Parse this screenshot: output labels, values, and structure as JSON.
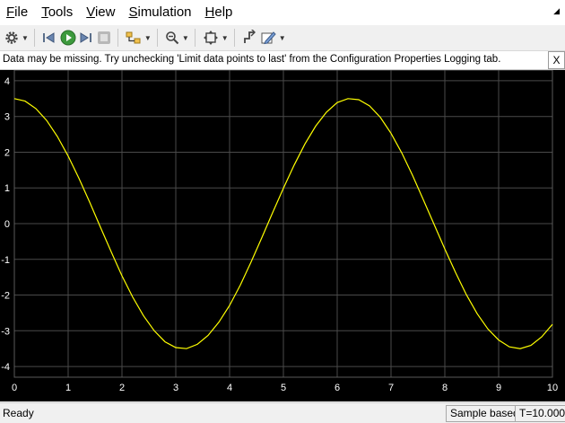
{
  "menu": {
    "items": [
      "File",
      "Tools",
      "View",
      "Simulation",
      "Help"
    ],
    "underline": [
      "F",
      "T",
      "V",
      "S",
      "H"
    ]
  },
  "toolbar": {
    "icons": [
      "settings-icon",
      "step-back-icon",
      "run-icon",
      "step-forward-icon",
      "stop-icon",
      "signal-select-icon",
      "zoom-icon",
      "fit-view-icon",
      "triggers-icon",
      "style-icon"
    ]
  },
  "infobar": {
    "message": "Data may be missing.  Try unchecking 'Limit data points to last' from the Configuration Properties Logging tab.",
    "close_label": "X"
  },
  "status": {
    "state": "Ready",
    "mode": "Sample based",
    "time": "T=10.000"
  },
  "colors": {
    "background": "#000000",
    "trace": "#ffff00",
    "grid": "#4a4a4a",
    "tick_text": "#ffffff"
  },
  "chart_data": {
    "type": "line",
    "xlim": [
      0,
      10
    ],
    "ylim": [
      -4.3,
      4.3
    ],
    "x_ticks": [
      "0",
      "1",
      "2",
      "3",
      "4",
      "5",
      "6",
      "7",
      "8",
      "9",
      "10"
    ],
    "y_ticks": [
      "4",
      "3",
      "2",
      "1",
      "0",
      "-1",
      "-2",
      "-3",
      "-4"
    ],
    "grid": true,
    "series": [
      {
        "color": "#ffff00",
        "x": [
          0,
          0.2,
          0.4,
          0.6,
          0.8,
          1.0,
          1.2,
          1.4,
          1.6,
          1.8,
          2.0,
          2.2,
          2.4,
          2.6,
          2.8,
          3.0,
          3.2,
          3.4,
          3.6,
          3.8,
          4.0,
          4.2,
          4.4,
          4.6,
          4.8,
          5.0,
          5.2,
          5.4,
          5.6,
          5.8,
          6.0,
          6.2,
          6.4,
          6.6,
          6.8,
          7.0,
          7.2,
          7.4,
          7.6,
          7.8,
          8.0,
          8.2,
          8.4,
          8.6,
          8.8,
          9.0,
          9.2,
          9.4,
          9.6,
          9.8,
          10.0
        ],
        "y": [
          3.5,
          3.43,
          3.22,
          2.89,
          2.44,
          1.89,
          1.27,
          0.6,
          -0.1,
          -0.79,
          -1.46,
          -2.06,
          -2.58,
          -3.0,
          -3.31,
          -3.47,
          -3.5,
          -3.38,
          -3.13,
          -2.76,
          -2.29,
          -1.72,
          -1.07,
          -0.39,
          0.31,
          0.99,
          1.64,
          2.23,
          2.73,
          3.12,
          3.39,
          3.5,
          3.47,
          3.3,
          2.98,
          2.53,
          1.98,
          1.35,
          0.67,
          -0.02,
          -0.71,
          -1.37,
          -1.99,
          -2.52,
          -2.95,
          -3.26,
          -3.45,
          -3.5,
          -3.41,
          -3.17,
          -2.82
        ]
      }
    ]
  }
}
